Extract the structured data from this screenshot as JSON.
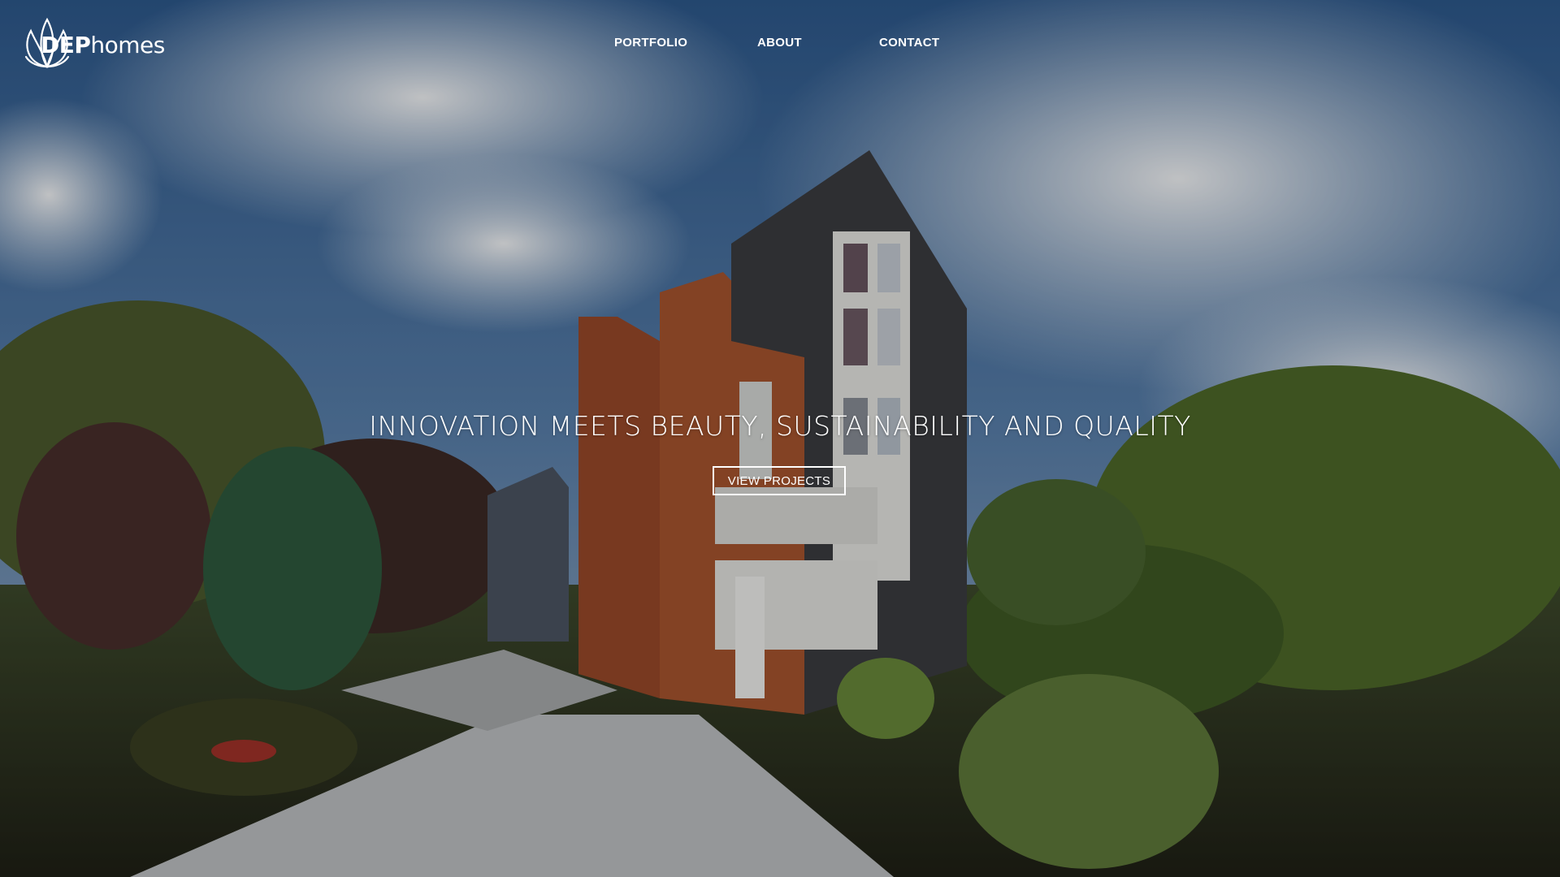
{
  "brand": {
    "logo_bold": "DEP",
    "logo_rest": "homes",
    "logo_icon": "lotus-icon"
  },
  "nav": {
    "items": [
      {
        "label": "PORTFOLIO"
      },
      {
        "label": "ABOUT"
      },
      {
        "label": "CONTACT"
      }
    ]
  },
  "hero": {
    "headline": "INNOVATION MEETS BEAUTY, SUSTAINABILITY AND QUALITY",
    "cta_label": "VIEW PROJECTS",
    "image_subject": "modern-house-photo"
  },
  "colors": {
    "text": "#ffffff",
    "overlay": "#000000"
  }
}
